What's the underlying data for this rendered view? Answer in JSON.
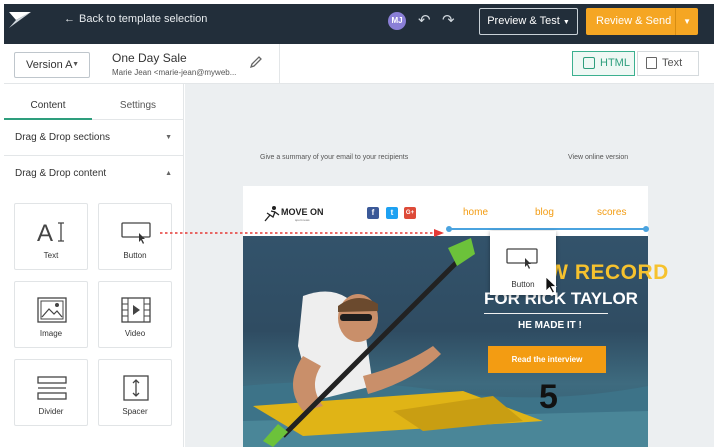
{
  "topbar": {
    "back_label": "Back to template selection",
    "avatar_initials": "MJ",
    "preview_label": "Preview & Test",
    "review_label": "Review & Send"
  },
  "header": {
    "version_label": "Version A",
    "email_name": "One Day Sale",
    "sender": "Marie Jean <marie-jean@myweb...",
    "html_tab": "HTML",
    "text_tab": "Text"
  },
  "sidebar": {
    "tabs": [
      "Content",
      "Settings"
    ],
    "sections": [
      {
        "label": "Drag & Drop sections",
        "expanded": false
      },
      {
        "label": "Drag & Drop content",
        "expanded": true
      }
    ],
    "blocks": [
      {
        "label": "Text",
        "icon": "text-icon"
      },
      {
        "label": "Button",
        "icon": "button-icon"
      },
      {
        "label": "Image",
        "icon": "image-icon"
      },
      {
        "label": "Video",
        "icon": "video-icon"
      },
      {
        "label": "Divider",
        "icon": "divider-icon"
      },
      {
        "label": "Spacer",
        "icon": "spacer-icon"
      }
    ]
  },
  "canvas": {
    "summary_hint": "Give a summary of your email to your recipients",
    "online_link": "View online version",
    "brand_name": "MOVE ON",
    "brand_sub": "sport news",
    "social": [
      "f",
      "t",
      "G+"
    ],
    "nav": [
      "home",
      "blog",
      "scores"
    ],
    "hero_title_1": "NEW RECORD",
    "hero_title_2": "FOR RICK TAYLOR",
    "hero_subtitle": "HE MADE IT !",
    "hero_button": "Read the interview",
    "drag_ghost_label": "Button"
  },
  "colors": {
    "topbar": "#222e3a",
    "accent_green": "#2e9e7d",
    "orange": "#f5a623",
    "drop_line": "#4aa3df",
    "drag_arrow": "#e53935"
  }
}
